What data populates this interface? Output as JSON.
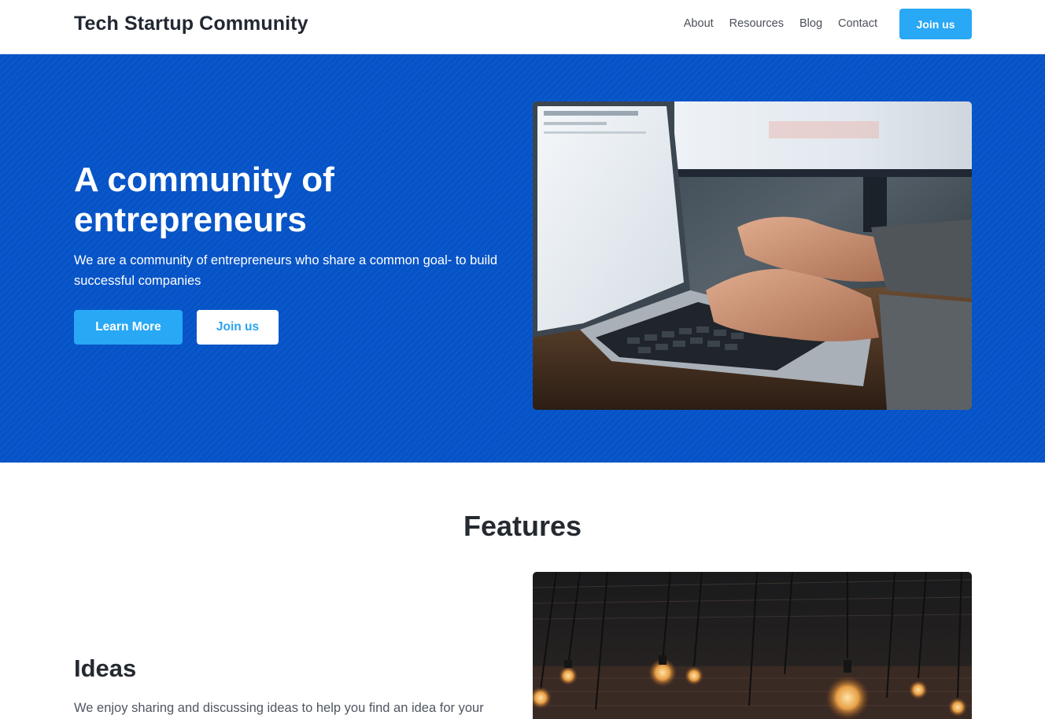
{
  "header": {
    "brand": "Tech Startup Community",
    "nav": [
      "About",
      "Resources",
      "Blog",
      "Contact"
    ],
    "join_label": "Join us"
  },
  "hero": {
    "title": "A community of entrepreneurs",
    "text": "We are a community of entrepreneurs who share a common goal- to build successful companies",
    "learn_more": "Learn More",
    "join_label": "Join us",
    "image_icon": "laptop-photo-icon"
  },
  "features": {
    "title": "Features",
    "items": [
      {
        "title": "Ideas",
        "text": "We enjoy sharing and discussing ideas to help you find an idea for your",
        "image_icon": "lightbulbs-photo-icon"
      }
    ]
  },
  "colors": {
    "primary": "#0553c7",
    "accent": "#28a8f5",
    "text_dark": "#252a31"
  }
}
